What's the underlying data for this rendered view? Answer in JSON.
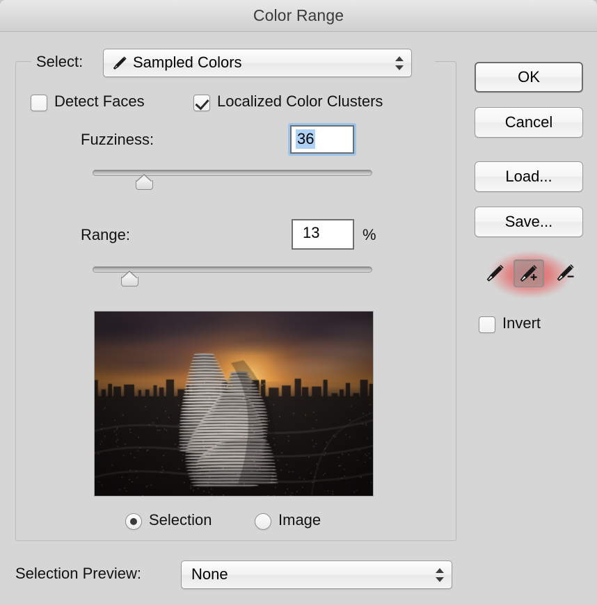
{
  "dialog": {
    "title": "Color Range",
    "background_color": "#d6d6d6",
    "highlight_color": "#e25858"
  },
  "select_row": {
    "label": "Select:",
    "value": "Sampled Colors",
    "icon": "eyedropper-icon",
    "stepper_icon": "updown-arrows-icon",
    "options": [
      "Sampled Colors"
    ]
  },
  "checkboxes": {
    "detect_faces": {
      "label": "Detect Faces",
      "checked": false
    },
    "localized_color_clusters": {
      "label": "Localized Color Clusters",
      "checked": true
    },
    "invert": {
      "label": "Invert",
      "checked": false
    }
  },
  "fuzziness": {
    "label": "Fuzziness:",
    "value": "36",
    "selected": true,
    "focused": true,
    "slider_percent": 16
  },
  "range": {
    "label": "Range:",
    "value": "13",
    "unit": "%",
    "slider_percent": 11
  },
  "preview": {
    "alt": "sunset-cityscape-preview",
    "radios": [
      {
        "label": "Selection",
        "selected": true
      },
      {
        "label": "Image",
        "selected": false
      }
    ]
  },
  "selection_preview": {
    "label": "Selection Preview:",
    "value": "None",
    "stepper_icon": "updown-arrows-icon",
    "options": [
      "None"
    ]
  },
  "buttons": [
    {
      "name": "ok",
      "label": "OK",
      "default": true
    },
    {
      "name": "cancel",
      "label": "Cancel",
      "default": false
    },
    {
      "name": "load",
      "label": "Load...",
      "default": false
    },
    {
      "name": "save",
      "label": "Save...",
      "default": false
    }
  ],
  "eyedropper_tools": [
    {
      "name": "eyedropper-sample",
      "icon": "eyedropper-icon",
      "active": false
    },
    {
      "name": "eyedropper-add",
      "icon": "eyedropper-plus-icon",
      "active": true
    },
    {
      "name": "eyedropper-subtract",
      "icon": "eyedropper-minus-icon",
      "active": false
    }
  ]
}
